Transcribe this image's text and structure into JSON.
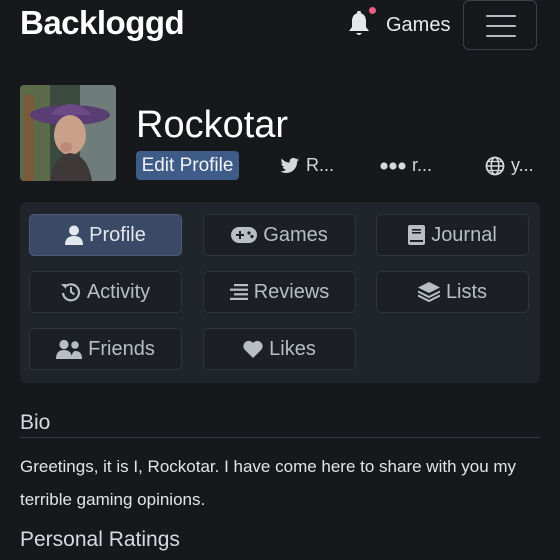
{
  "header": {
    "logo": "Backloggd",
    "games_label": "Games",
    "notification_dot_color": "#ea5b86"
  },
  "profile": {
    "username": "Rockotar",
    "edit_label": "Edit Profile",
    "social": [
      {
        "icon": "twitter-icon",
        "text": "R..."
      },
      {
        "icon": "backloggd-dots-icon",
        "text": "r..."
      },
      {
        "icon": "globe-icon",
        "text": "y..."
      }
    ]
  },
  "nav": {
    "active": "Profile",
    "items": [
      {
        "label": "Profile",
        "icon": "user-icon"
      },
      {
        "label": "Games",
        "icon": "gamepad-icon"
      },
      {
        "label": "Journal",
        "icon": "book-icon"
      },
      {
        "label": "Activity",
        "icon": "history-icon"
      },
      {
        "label": "Reviews",
        "icon": "lines-icon"
      },
      {
        "label": "Lists",
        "icon": "layers-icon"
      },
      {
        "label": "Friends",
        "icon": "users-icon"
      },
      {
        "label": "Likes",
        "icon": "heart-icon"
      }
    ]
  },
  "bio": {
    "heading": "Bio",
    "text": "Greetings, it is I, Rockotar. I have come here to share with you my terrible gaming opinions."
  },
  "ratings": {
    "heading": "Personal Ratings"
  },
  "colors": {
    "background": "#16181c",
    "panel": "#20242b",
    "accent": "#3f5b87",
    "active_tab": "#3a4a66"
  }
}
